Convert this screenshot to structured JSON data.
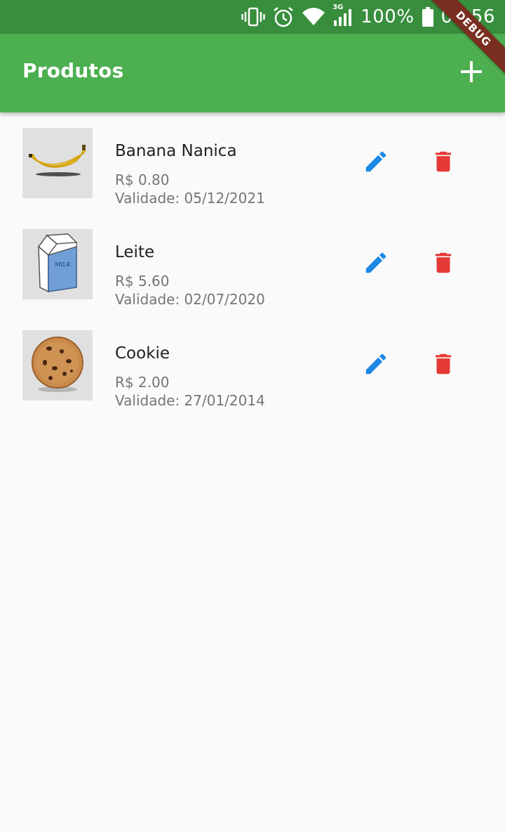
{
  "status_bar": {
    "network_type": "3G",
    "battery_percent": "100%",
    "time": "06:56",
    "icons": [
      "vibrate-icon",
      "alarm-icon",
      "wifi-icon",
      "signal-icon",
      "battery-icon"
    ]
  },
  "debug_banner": {
    "label": "DEBUG"
  },
  "app_bar": {
    "title": "Produtos",
    "add_icon": "plus-icon"
  },
  "products": [
    {
      "name": "Banana Nanica",
      "price": "R$ 0.80",
      "validity": "Validade: 05/12/2021",
      "image": "banana-image"
    },
    {
      "name": "Leite",
      "price": "R$ 5.60",
      "validity": "Validade: 02/07/2020",
      "image": "milk-carton-image",
      "image_label": "MILK"
    },
    {
      "name": "Cookie",
      "price": "R$ 2.00",
      "validity": "Validade: 27/01/2014",
      "image": "cookie-image"
    }
  ],
  "colors": {
    "status_bar": "#388e3c",
    "app_bar": "#4caf50",
    "edit_icon": "#1e88e5",
    "delete_icon": "#e53935",
    "background": "#fafafa",
    "thumb_bg": "#e0e0e0"
  }
}
